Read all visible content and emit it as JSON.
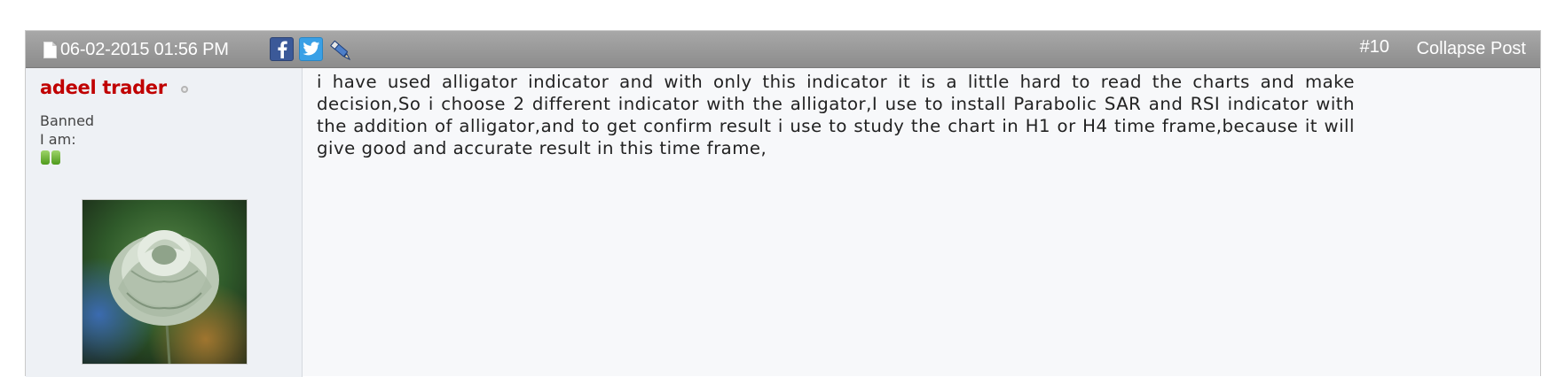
{
  "post": {
    "date": "06-02-2015 01:56 PM",
    "number": "#10",
    "collapse_label": "Collapse Post",
    "share_icons": [
      "facebook-icon",
      "twitter-icon",
      "pencil-link-icon"
    ]
  },
  "user": {
    "name": "adeel trader",
    "title": "Banned",
    "i_am_label": "I am:",
    "name_color": "#c00000",
    "reputation_pips": 2
  },
  "message": {
    "text": "i have used alligator indicator and with only this indicator it is a little hard to read the charts and make decision,So i choose 2 different indicator with the alligator,I use to install Parabolic SAR and RSI indicator with the addition of alligator,and to get confirm result i use to study the chart in H1 or H4 time frame,because it will give good and accurate result in this time frame,"
  }
}
